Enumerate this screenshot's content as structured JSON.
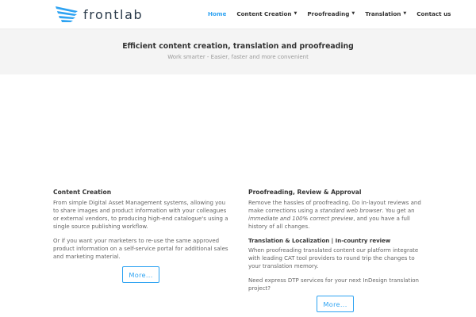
{
  "brand": {
    "logo_text": "frontlab",
    "logo_icon": "frontlab-wing-logo",
    "accent_color": "#2ea3f2"
  },
  "nav": {
    "items": [
      {
        "label": "Home",
        "active": true,
        "dropdown": false
      },
      {
        "label": "Content Creation",
        "active": false,
        "dropdown": true
      },
      {
        "label": "Proofreading",
        "active": false,
        "dropdown": true
      },
      {
        "label": "Translation",
        "active": false,
        "dropdown": true
      },
      {
        "label": "Contact us",
        "active": false,
        "dropdown": false
      }
    ]
  },
  "hero": {
    "title": "Efficient content creation, translation and proofreading",
    "subtitle": "Work smarter - Easier, faster and more convenient"
  },
  "left_column": {
    "heading": "Content Creation",
    "paragraph1": "From simple Digital Asset Management systems, allowing you to share images and product information with your colleagues or external vendors, to producing high-end catalogue's using a single source publishing workflow.",
    "paragraph2": "Or if you want your marketers to re-use the same approved product information on a self-service portal for additional sales and marketing material.",
    "button_label": "More..."
  },
  "right_column": {
    "heading": "Proofreading, Review & Approval",
    "p1_part1": "Remove the hassles of proofreading. Do in-layout reviews and make corrections using a ",
    "p1_em1": "standard web browser",
    "p1_part2": ". You get an ",
    "p1_em2": "immediate and 100% correct preview",
    "p1_part3": ", and you have a full history of all changes.",
    "subheading": "Translation & Localization | In-country review",
    "paragraph2": "When proofreading translated content our platform integrate with leading CAT tool providers to round trip the changes to your translation memory.",
    "paragraph3": "Need express DTP services for your next InDesign translation project?",
    "button_label": "More..."
  }
}
